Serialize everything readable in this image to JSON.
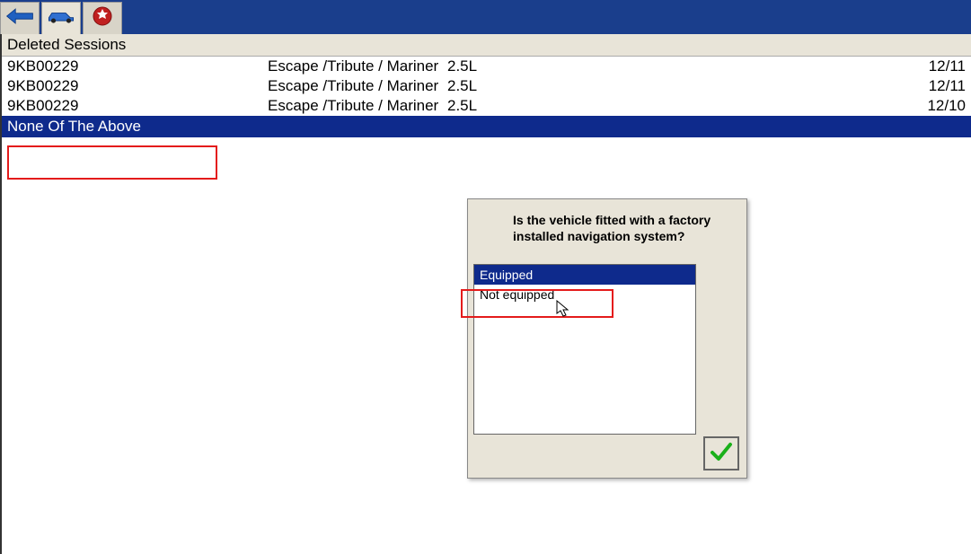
{
  "section_header": "Deleted Sessions",
  "sessions": [
    {
      "vin": "9KB00229",
      "vehicle": "Escape /Tribute / Mariner",
      "engine": "2.5L",
      "date": "12/11"
    },
    {
      "vin": "9KB00229",
      "vehicle": "Escape /Tribute / Mariner",
      "engine": "2.5L",
      "date": "12/11"
    },
    {
      "vin": "9KB00229",
      "vehicle": "Escape /Tribute / Mariner",
      "engine": "2.5L",
      "date": "12/10"
    }
  ],
  "none_label": "None Of The Above",
  "dialog": {
    "question": "Is the vehicle fitted with a factory installed navigation system?",
    "options": {
      "equipped": "Equipped",
      "not_equipped": "Not equipped"
    }
  },
  "colors": {
    "title_bar": "#1a3e8c",
    "panel_bg": "#e8e4d8",
    "selected_bg": "#0e2a8c",
    "highlight_border": "#e41b1b"
  }
}
